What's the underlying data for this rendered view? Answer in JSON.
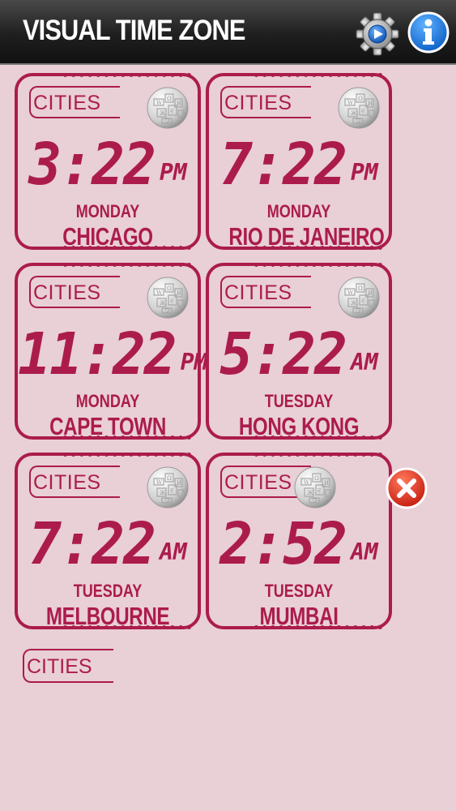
{
  "header": {
    "title": "VISUAL TIME ZONE"
  },
  "icons": {
    "settings": "gear-icon",
    "info": "info-icon",
    "globe": "wikipedia-globe-icon",
    "close": "close-icon"
  },
  "colors": {
    "accent": "#ab1c4c",
    "background": "#e9cfd6",
    "info_blue": "#1a7fd8",
    "close_red": "#d4271b"
  },
  "cities_label": "CITIES",
  "clocks": [
    {
      "time": "3:22",
      "ampm": "PM",
      "day": "MONDAY",
      "city": "CHICAGO"
    },
    {
      "time": "7:22",
      "ampm": "PM",
      "day": "MONDAY",
      "city": "RIO DE JANEIRO"
    },
    {
      "time": "11:22",
      "ampm": "PM",
      "day": "MONDAY",
      "city": "CAPE TOWN"
    },
    {
      "time": "5:22",
      "ampm": "AM",
      "day": "TUESDAY",
      "city": "HONG KONG"
    },
    {
      "time": "7:22",
      "ampm": "AM",
      "day": "TUESDAY",
      "city": "MELBOURNE"
    },
    {
      "time": "2:52",
      "ampm": "AM",
      "day": "TUESDAY",
      "city": "MUMBAI"
    }
  ],
  "add_clock": {
    "label": "CITIES"
  }
}
